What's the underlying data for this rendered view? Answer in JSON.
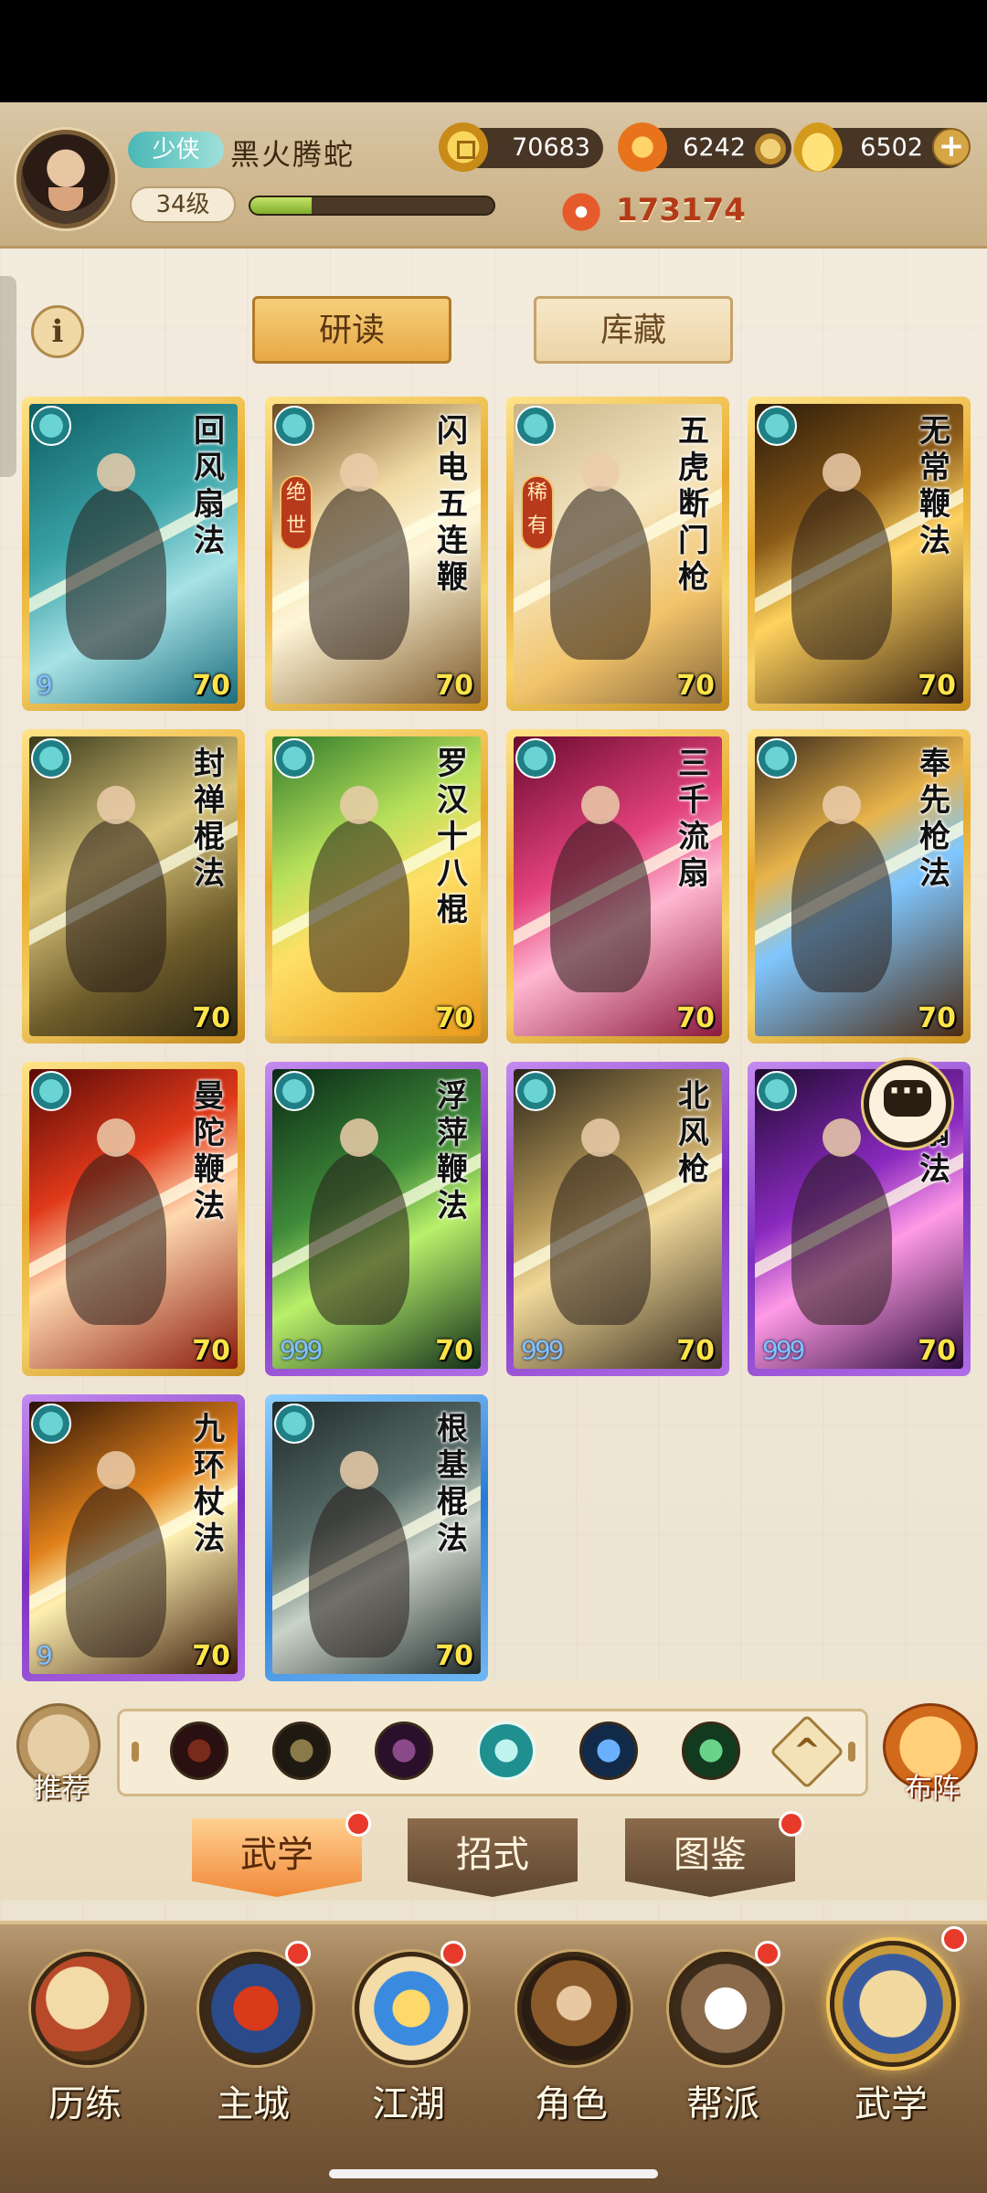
{
  "header": {
    "title_badge": "少侠",
    "player_name": "黑火腾蛇",
    "level": "34级",
    "exp_progress": 0.25,
    "copper": "70683",
    "fire": "6242",
    "gold": "6502",
    "power": "173174"
  },
  "tabs": {
    "study": "研读",
    "storage": "库藏"
  },
  "cards": [
    {
      "name": "回风扇法",
      "level": "70",
      "frame": "gold",
      "art": "bg-teal",
      "rarity": "",
      "orbs": "9"
    },
    {
      "name": "闪电五连鞭",
      "level": "70",
      "frame": "gold",
      "art": "bg-amber",
      "rarity": "绝世",
      "orbs": ""
    },
    {
      "name": "五虎断门枪",
      "level": "70",
      "frame": "gold",
      "art": "bg-sand",
      "rarity": "稀有",
      "orbs": ""
    },
    {
      "name": "无常鞭法",
      "level": "70",
      "frame": "gold",
      "art": "bg-dark-gold",
      "rarity": "",
      "orbs": ""
    },
    {
      "name": "封禅棍法",
      "level": "70",
      "frame": "gold",
      "art": "bg-olive",
      "rarity": "",
      "orbs": ""
    },
    {
      "name": "罗汉十八棍",
      "level": "70",
      "frame": "gold",
      "art": "bg-green-yellow",
      "rarity": "",
      "orbs": ""
    },
    {
      "name": "三千流扇",
      "level": "70",
      "frame": "gold",
      "art": "bg-pink",
      "rarity": "",
      "orbs": ""
    },
    {
      "name": "奉先枪法",
      "level": "70",
      "frame": "gold",
      "art": "bg-storm",
      "rarity": "",
      "orbs": ""
    },
    {
      "name": "曼陀鞭法",
      "level": "70",
      "frame": "gold",
      "art": "bg-red",
      "rarity": "",
      "orbs": ""
    },
    {
      "name": "浮萍鞭法",
      "level": "70",
      "frame": "purple",
      "art": "bg-green",
      "rarity": "",
      "orbs": "999"
    },
    {
      "name": "北风枪",
      "level": "70",
      "frame": "purple",
      "art": "bg-sepia",
      "rarity": "",
      "orbs": "999"
    },
    {
      "name": "忠扇法",
      "level": "70",
      "frame": "purple",
      "art": "bg-violet",
      "rarity": "",
      "orbs": "999"
    },
    {
      "name": "九环杖法",
      "level": "70",
      "frame": "purple",
      "art": "bg-flame",
      "rarity": "",
      "orbs": "9"
    },
    {
      "name": "根基棍法",
      "level": "70",
      "frame": "blue",
      "art": "bg-slate",
      "rarity": "",
      "orbs": ""
    }
  ],
  "filter": {
    "recommend_label": "推荐",
    "formation_label": "布阵"
  },
  "subtabs": {
    "martial": "武学",
    "moves": "招式",
    "atlas": "图鉴"
  },
  "nav": {
    "trial": "历练",
    "city": "主城",
    "jianghu": "江湖",
    "character": "角色",
    "guild": "帮派",
    "martial": "武学"
  },
  "colors": {
    "gold_frame": "#e6a82a",
    "purple_frame": "#7b2fbf",
    "blue_frame": "#2a7ad6",
    "level_text": "#ffe44a",
    "red_dot": "#e83a2a"
  }
}
